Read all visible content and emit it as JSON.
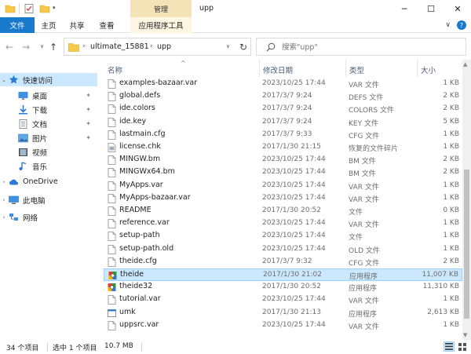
{
  "titlebar": {
    "manage_tab": "管理",
    "window_title": "upp",
    "minimize": "─",
    "maximize": "☐",
    "close": "✕"
  },
  "ribbon": {
    "tabs": {
      "file": "文件",
      "home": "主页",
      "share": "共享",
      "view": "查看",
      "app_tools": "应用程序工具"
    },
    "expand": "∨",
    "help": "?"
  },
  "address": {
    "path": [
      "ultimate_15881",
      "upp"
    ],
    "separator": "›",
    "search_placeholder": "搜索\"upp\""
  },
  "nav_pane": {
    "items": [
      {
        "label": "快速访问",
        "icon": "star-icon",
        "expand": "⌄",
        "pinned": false,
        "selected": true
      },
      {
        "label": "桌面",
        "icon": "desktop-icon",
        "expand": "",
        "pinned": true,
        "selected": false
      },
      {
        "label": "下载",
        "icon": "download-icon",
        "expand": "",
        "pinned": true,
        "selected": false
      },
      {
        "label": "文档",
        "icon": "document-icon",
        "expand": "",
        "pinned": true,
        "selected": false
      },
      {
        "label": "图片",
        "icon": "picture-icon",
        "expand": "",
        "pinned": true,
        "selected": false
      },
      {
        "label": "视频",
        "icon": "video-icon",
        "expand": "",
        "pinned": false,
        "selected": false
      },
      {
        "label": "音乐",
        "icon": "music-icon",
        "expand": "",
        "pinned": false,
        "selected": false
      },
      {
        "label": "OneDrive",
        "icon": "cloud-icon",
        "expand": "›",
        "pinned": false,
        "selected": false
      },
      {
        "label": "此电脑",
        "icon": "computer-icon",
        "expand": "›",
        "pinned": false,
        "selected": false
      },
      {
        "label": "网络",
        "icon": "network-icon",
        "expand": "›",
        "pinned": false,
        "selected": false
      }
    ],
    "pin_glyph": "📌"
  },
  "columns": {
    "name": "名称",
    "date": "修改日期",
    "type": "类型",
    "size": "大小",
    "sort_indicator": "^"
  },
  "files": [
    {
      "name": "examples-bazaar.var",
      "date": "2023/10/25 17:44",
      "type": "VAR 文件",
      "size": "1 KB",
      "icon": "file-icon",
      "selected": false
    },
    {
      "name": "global.defs",
      "date": "2017/3/7 9:24",
      "type": "DEFS 文件",
      "size": "2 KB",
      "icon": "file-icon",
      "selected": false
    },
    {
      "name": "ide.colors",
      "date": "2017/3/7 9:24",
      "type": "COLORS 文件",
      "size": "2 KB",
      "icon": "file-icon",
      "selected": false
    },
    {
      "name": "ide.key",
      "date": "2017/3/7 9:24",
      "type": "KEY 文件",
      "size": "5 KB",
      "icon": "file-icon",
      "selected": false
    },
    {
      "name": "lastmain.cfg",
      "date": "2017/3/7 9:33",
      "type": "CFG 文件",
      "size": "1 KB",
      "icon": "file-icon",
      "selected": false
    },
    {
      "name": "license.chk",
      "date": "2017/1/30 21:15",
      "type": "恢复的文件碎片",
      "size": "1 KB",
      "icon": "recovered-file-icon",
      "selected": false
    },
    {
      "name": "MINGW.bm",
      "date": "2023/10/25 17:44",
      "type": "BM 文件",
      "size": "2 KB",
      "icon": "file-icon",
      "selected": false
    },
    {
      "name": "MINGWx64.bm",
      "date": "2023/10/25 17:44",
      "type": "BM 文件",
      "size": "2 KB",
      "icon": "file-icon",
      "selected": false
    },
    {
      "name": "MyApps.var",
      "date": "2023/10/25 17:44",
      "type": "VAR 文件",
      "size": "1 KB",
      "icon": "file-icon",
      "selected": false
    },
    {
      "name": "MyApps-bazaar.var",
      "date": "2023/10/25 17:44",
      "type": "VAR 文件",
      "size": "1 KB",
      "icon": "file-icon",
      "selected": false
    },
    {
      "name": "README",
      "date": "2017/1/30 20:52",
      "type": "文件",
      "size": "0 KB",
      "icon": "file-icon",
      "selected": false
    },
    {
      "name": "reference.var",
      "date": "2023/10/25 17:44",
      "type": "VAR 文件",
      "size": "1 KB",
      "icon": "file-icon",
      "selected": false
    },
    {
      "name": "setup-path",
      "date": "2023/10/25 17:44",
      "type": "文件",
      "size": "1 KB",
      "icon": "file-icon",
      "selected": false
    },
    {
      "name": "setup-path.old",
      "date": "2023/10/25 17:44",
      "type": "OLD 文件",
      "size": "1 KB",
      "icon": "file-icon",
      "selected": false
    },
    {
      "name": "theide.cfg",
      "date": "2017/3/7 9:32",
      "type": "CFG 文件",
      "size": "2 KB",
      "icon": "file-icon",
      "selected": false
    },
    {
      "name": "theide",
      "date": "2017/1/30 21:02",
      "type": "应用程序",
      "size": "11,007 KB",
      "icon": "app-icon",
      "selected": true
    },
    {
      "name": "theide32",
      "date": "2017/1/30 20:52",
      "type": "应用程序",
      "size": "11,310 KB",
      "icon": "app-icon",
      "selected": false
    },
    {
      "name": "tutorial.var",
      "date": "2023/10/25 17:44",
      "type": "VAR 文件",
      "size": "1 KB",
      "icon": "file-icon",
      "selected": false
    },
    {
      "name": "umk",
      "date": "2017/1/30 21:13",
      "type": "应用程序",
      "size": "2,613 KB",
      "icon": "console-app-icon",
      "selected": false
    },
    {
      "name": "uppsrc.var",
      "date": "2023/10/25 17:44",
      "type": "VAR 文件",
      "size": "1 KB",
      "icon": "file-icon",
      "selected": false
    }
  ],
  "status": {
    "count": "34 个项目",
    "selection": "选中 1 个项目",
    "size": "10.7 MB"
  },
  "colors": {
    "accent": "#1979ca",
    "selection_bg": "#cce8ff",
    "selection_border": "#99d1ff",
    "manage_tab": "#f4e3b7",
    "header_text": "#4c607a"
  }
}
